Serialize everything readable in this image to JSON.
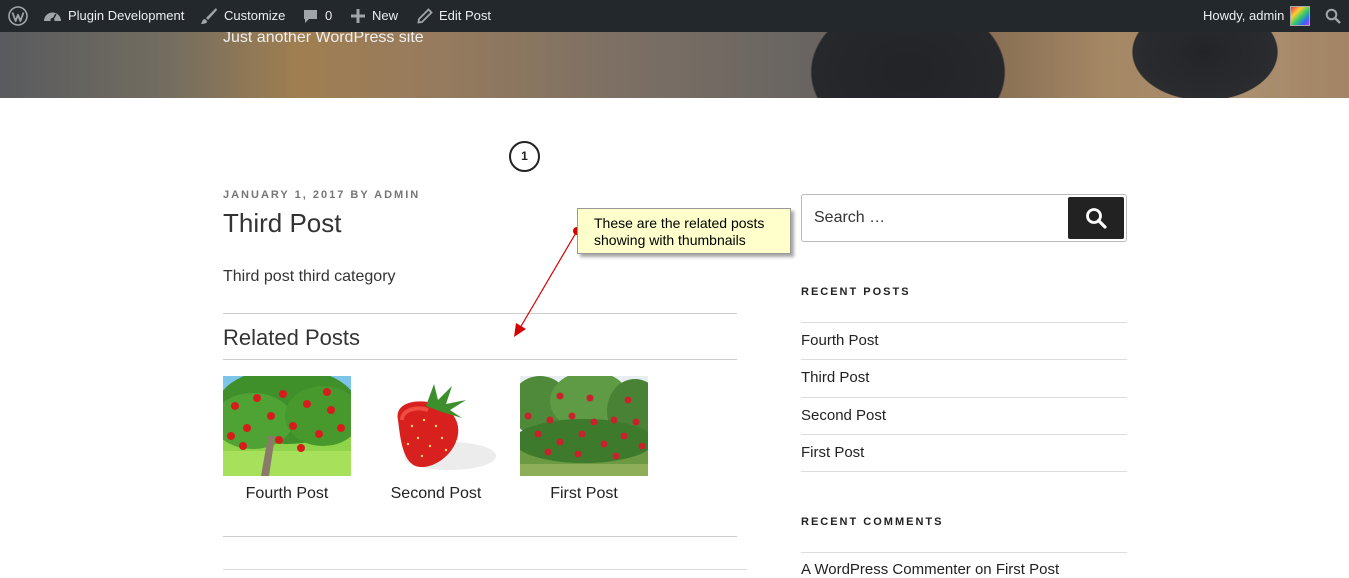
{
  "adminbar": {
    "site_name": "Plugin Development",
    "customize": "Customize",
    "comments_count": "0",
    "new": "New",
    "edit_post": "Edit Post",
    "howdy": "Howdy, admin"
  },
  "header": {
    "tagline": "Just another WordPress site"
  },
  "step_number": "1",
  "post": {
    "date": "January 1, 2017",
    "by": "by",
    "author": "admin",
    "title": "Third Post",
    "body": "Third post third category"
  },
  "related": {
    "heading": "Related Posts",
    "items": [
      {
        "title": "Fourth Post",
        "thumb": "apple-tree-image"
      },
      {
        "title": "Second Post",
        "thumb": "strawberry-image"
      },
      {
        "title": "First Post",
        "thumb": "apple-orchard-image"
      }
    ]
  },
  "annotation": {
    "line1": "These are the related posts",
    "line2": "showing with thumbnails",
    "color": "#ffffcc",
    "arrow_color": "#d40000"
  },
  "sidebar": {
    "search_placeholder": "Search …",
    "recent_posts_title": "Recent Posts",
    "recent_posts": [
      "Fourth Post",
      "Third Post",
      "Second Post",
      "First Post"
    ],
    "recent_comments_title": "Recent Comments",
    "recent_comment": {
      "author": "A WordPress Commenter",
      "on": "on",
      "post": "First Post"
    }
  }
}
